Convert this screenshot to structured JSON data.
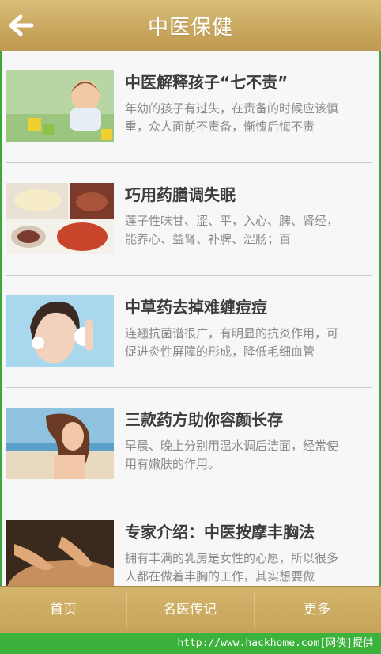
{
  "header": {
    "title": "中医保健"
  },
  "articles": [
    {
      "title": "中医解释孩子“七不责”",
      "desc": "年幼的孩子有过失，在责备的时候应该慎重，众人面前不责备，惭愧后悔不责"
    },
    {
      "title": "巧用药膳调失眠",
      "desc": "莲子性味甘、涩、平，入心、脾、肾经，能养心、益肾、补脾、涩肠；百"
    },
    {
      "title": "中草药去掉难缠痘痘",
      "desc": "连翘抗菌谱很广，有明显的抗炎作用，可促进炎性屏障的形成，降低毛细血管"
    },
    {
      "title": "三款药方助你容颜长存",
      "desc": "早晨、晚上分别用温水调后洁面，经常使用有嫩肤的作用。"
    },
    {
      "title": "专家介绍：中医按摩丰胸法",
      "desc": "拥有丰满的乳房是女性的心愿，所以很多人都在做着丰胸的工作，其实想要做"
    }
  ],
  "tabs": [
    "首页",
    "名医传记",
    "更多"
  ],
  "footer": {
    "text": "http://www.hackhome.com[网侠]提供"
  },
  "colors": {
    "header": "#caa85f",
    "tabbar": "#c6a35a",
    "footer": "#3bb23b"
  }
}
